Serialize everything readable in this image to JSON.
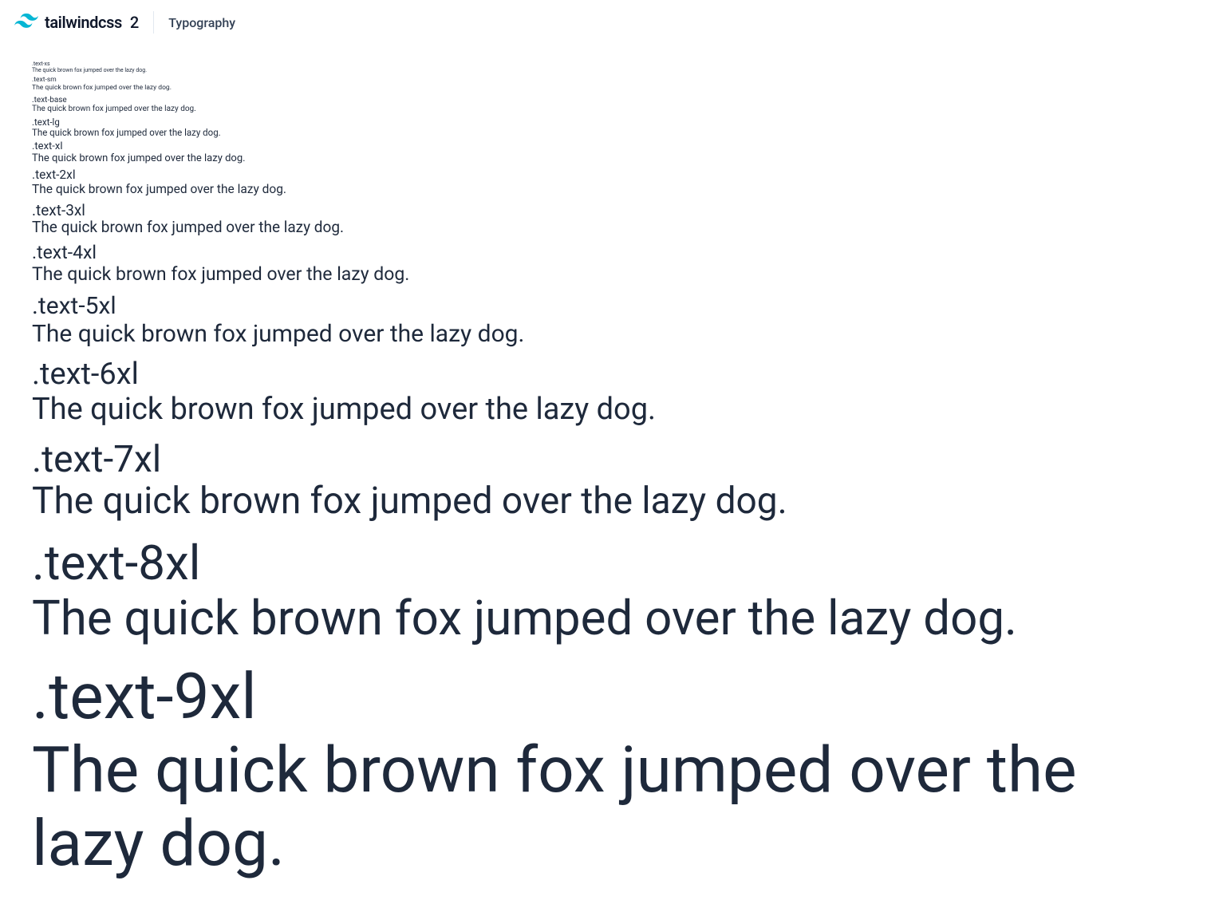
{
  "header": {
    "brand_wordmark": "tailwindcss",
    "brand_version": "2",
    "page_title": "Typography"
  },
  "sample_text": "The quick brown fox jumped over the lazy dog.",
  "samples": [
    {
      "label": ".text-xs"
    },
    {
      "label": ".text-sm"
    },
    {
      "label": ".text-base"
    },
    {
      "label": ".text-lg"
    },
    {
      "label": ".text-xl"
    },
    {
      "label": ".text-2xl"
    },
    {
      "label": ".text-3xl"
    },
    {
      "label": ".text-4xl"
    },
    {
      "label": ".text-5xl"
    },
    {
      "label": ".text-6xl"
    },
    {
      "label": ".text-7xl"
    },
    {
      "label": ".text-8xl"
    },
    {
      "label": ".text-9xl"
    }
  ]
}
